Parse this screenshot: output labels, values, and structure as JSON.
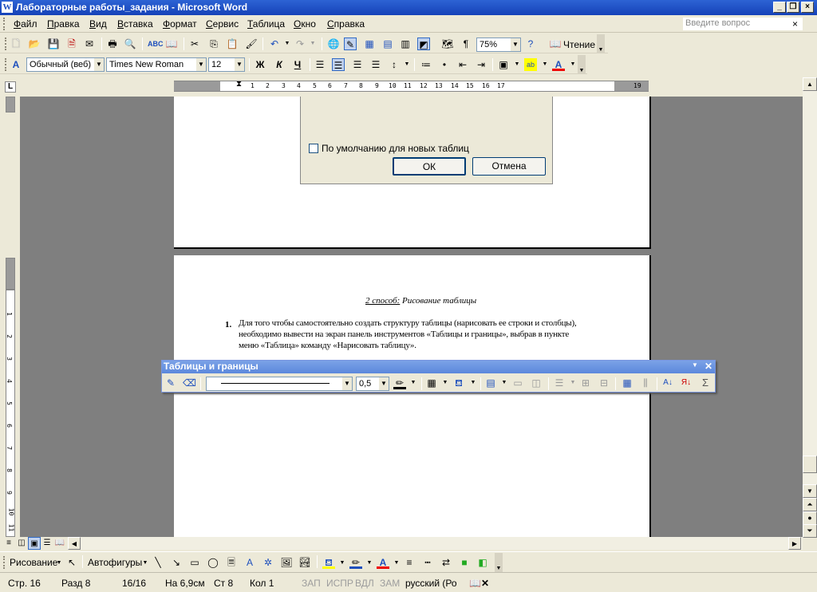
{
  "window": {
    "title": "Лабораторные работы_задания - Microsoft Word",
    "app_icon": "W"
  },
  "menu": {
    "items": [
      "Файл",
      "Правка",
      "Вид",
      "Вставка",
      "Формат",
      "Сервис",
      "Таблица",
      "Окно",
      "Справка"
    ],
    "help_placeholder": "Введите вопрос",
    "close": "×"
  },
  "standard_toolbar": {
    "zoom": "75%",
    "read_label": "Чтение",
    "pilcrow": "¶"
  },
  "format_toolbar": {
    "style": "Обычный (веб)",
    "font": "Times New Roman",
    "size": "12",
    "bold": "Ж",
    "italic": "К",
    "underline": "Ч",
    "font_color_letter": "A"
  },
  "ruler": {
    "ticks": [
      "1",
      "2",
      "3",
      "4",
      "5",
      "6",
      "7",
      "8",
      "9",
      "10",
      "11",
      "12",
      "13",
      "14",
      "15",
      "16",
      "17",
      "19"
    ],
    "vticks": [
      "1",
      "2",
      "3",
      "4",
      "5",
      "6",
      "7",
      "8",
      "9",
      "10",
      "11"
    ],
    "tab_marker": "L"
  },
  "dialog": {
    "checkbox_label": "По умолчанию для новых таблиц",
    "ok": "ОК",
    "cancel": "Отмена"
  },
  "page2": {
    "heading_underlined": "2 способ:",
    "heading_rest": " Рисование таблицы",
    "list_number": "1.",
    "paragraph": "Для того чтобы самостоятельно создать структуру таблицы (нарисовать ее строки и столбцы), необходимо вывести на экран панель инструментов «Таблицы и границы», выбрав в пункте меню «Таблица» команду «Нарисовать таблицу»."
  },
  "tables_toolbar": {
    "title": "Таблицы и границы",
    "line_weight": "0,5",
    "sigma": "Σ"
  },
  "draw_toolbar": {
    "drawing": "Рисование",
    "autoshapes": "Автофигуры"
  },
  "status": {
    "page": "Стр. 16",
    "section": "Разд 8",
    "pages": "16/16",
    "at": "На 6,9см",
    "line": "Ст 8",
    "col": "Кол 1",
    "rec": "ЗАП",
    "trk": "ИСПР",
    "ext": "ВДЛ",
    "ovr": "ЗАМ",
    "lang": "русский (Ро"
  }
}
